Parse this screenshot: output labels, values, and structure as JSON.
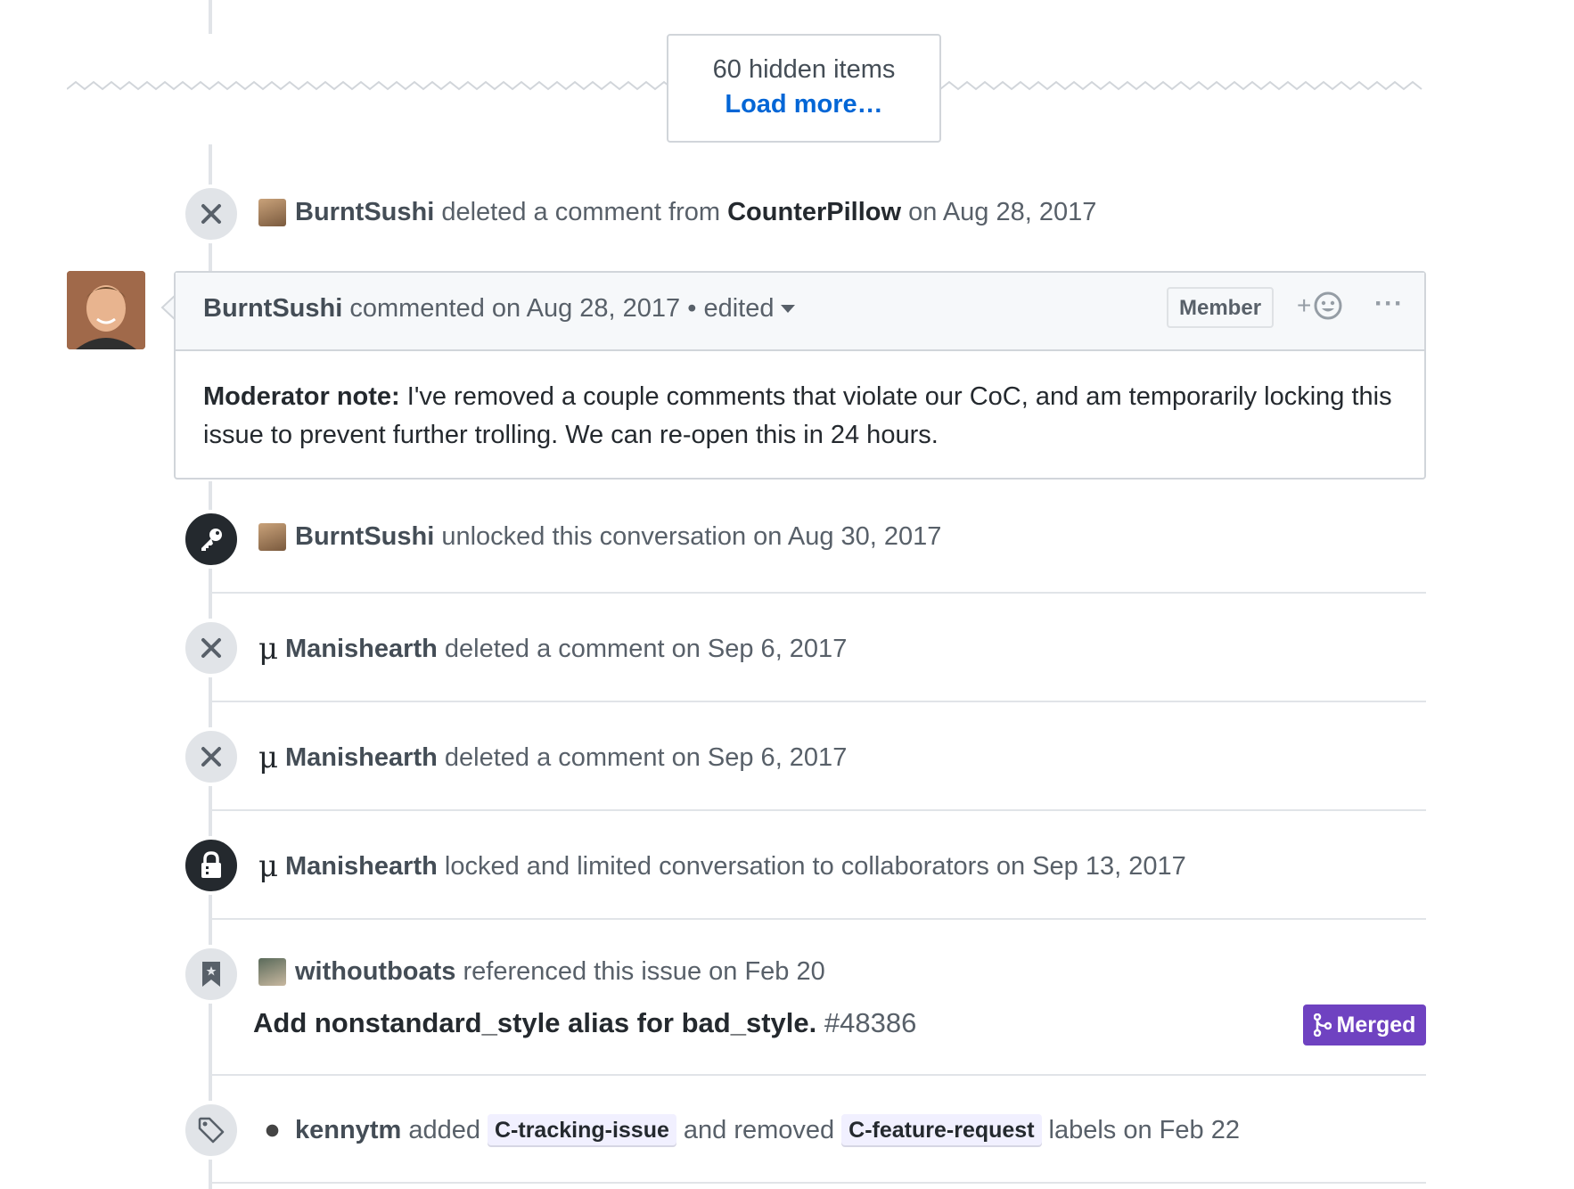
{
  "hidden": {
    "count_text": "60 hidden items",
    "load_more": "Load more…"
  },
  "events": {
    "deleted_1": {
      "author": "BurntSushi",
      "text1": "deleted a comment from",
      "target": "CounterPillow",
      "text2": "on Aug 28, 2017"
    },
    "comment": {
      "author": "BurntSushi",
      "meta": "commented on Aug 28, 2017",
      "dot": "•",
      "edited": "edited",
      "role": "Member",
      "reaction_plus": "+",
      "more": "···",
      "bold": "Moderator note:",
      "body": " I've removed a couple comments that violate our CoC, and am temporarily locking this issue to prevent further trolling. We can re-open this in 24 hours."
    },
    "unlocked": {
      "author": "BurntSushi",
      "text": "unlocked this conversation on Aug 30, 2017"
    },
    "deleted_2": {
      "glyph": "μ",
      "author": "Manishearth",
      "text": "deleted a comment on Sep 6, 2017"
    },
    "deleted_3": {
      "glyph": "μ",
      "author": "Manishearth",
      "text": "deleted a comment on Sep 6, 2017"
    },
    "locked": {
      "glyph": "μ",
      "author": "Manishearth",
      "text": "locked and limited conversation to collaborators on Sep 13, 2017"
    },
    "referenced": {
      "author": "withoutboats",
      "text": "referenced this issue on Feb 20",
      "pr_title": "Add nonstandard_style alias for bad_style.",
      "pr_number": "#48386",
      "status": "Merged"
    },
    "labels": {
      "author": "kennytm",
      "added": "added",
      "label_added": "C-tracking-issue",
      "removed": "and removed",
      "label_removed": "C-feature-request",
      "tail": "labels on Feb 22"
    }
  },
  "colors": {
    "link": "#0366d6",
    "merged": "#6f42c1",
    "line": "#e1e4e8"
  },
  "icons": [
    "x-icon",
    "key-icon",
    "lock-icon",
    "bookmark-icon",
    "tag-icon",
    "smiley-icon",
    "git-merge-icon",
    "triangle-down-icon"
  ]
}
